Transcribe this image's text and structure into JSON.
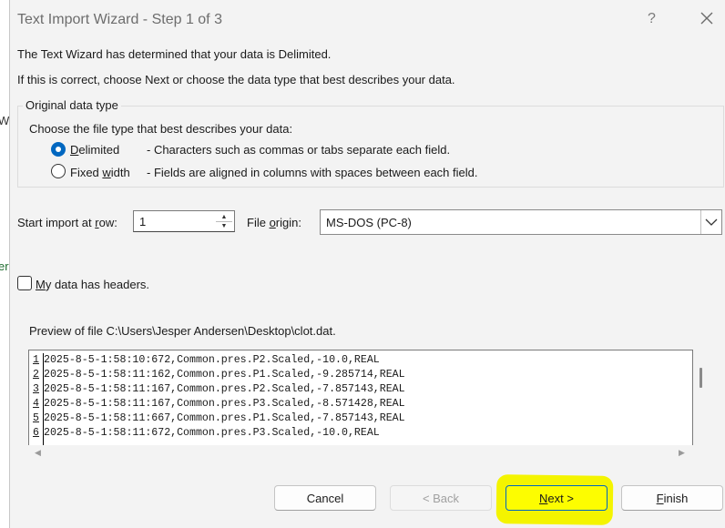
{
  "background": {
    "fragments": [
      "W",
      "er"
    ]
  },
  "dialog": {
    "title": "Text Import Wizard - Step 1 of 3",
    "help_label": "?",
    "intro_1": "The Text Wizard has determined that your data is Delimited.",
    "intro_2": "If this is correct, choose Next or choose the data type that best describes your data."
  },
  "original_type": {
    "legend": "Original data type",
    "prompt": "Choose the file type that best describes your data:",
    "options": [
      {
        "label_u": "D",
        "label_rest": "elimited",
        "desc": "- Characters such as commas or tabs separate each field.",
        "selected": true
      },
      {
        "label_pre": "Fixed ",
        "label_u": "w",
        "label_rest": "idth",
        "desc": "- Fields are aligned in columns with spaces between each field.",
        "selected": false
      }
    ]
  },
  "start_row": {
    "label_pre": "Start import at ",
    "label_u": "r",
    "label_rest": "ow:",
    "value": "1"
  },
  "file_origin": {
    "label_pre": "File ",
    "label_u": "o",
    "label_rest": "rigin:",
    "value": "MS-DOS (PC-8)"
  },
  "headers": {
    "label_u": "M",
    "label_rest": "y data has headers.",
    "checked": false
  },
  "preview": {
    "caption": "Preview of file C:\\Users\\Jesper Andersen\\Desktop\\clot.dat.",
    "rows": [
      {
        "num": "1",
        "text": "2025-8-5-1:58:10:672,Common.pres.P2.Scaled,-10.0,REAL"
      },
      {
        "num": "2",
        "text": "2025-8-5-1:58:11:162,Common.pres.P1.Scaled,-9.285714,REAL"
      },
      {
        "num": "3",
        "text": "2025-8-5-1:58:11:167,Common.pres.P2.Scaled,-7.857143,REAL"
      },
      {
        "num": "4",
        "text": "2025-8-5-1:58:11:167,Common.pres.P3.Scaled,-8.571428,REAL"
      },
      {
        "num": "5",
        "text": "2025-8-5-1:58:11:667,Common.pres.P1.Scaled,-7.857143,REAL"
      },
      {
        "num": "6",
        "text": "2025-8-5-1:58:11:672,Common.pres.P3.Scaled,-10.0,REAL"
      }
    ]
  },
  "buttons": {
    "cancel": "Cancel",
    "back": "< Back",
    "next_u": "N",
    "next_rest": "ext >",
    "finish_u": "F",
    "finish_rest": "inish"
  },
  "colors": {
    "accent": "#0067c0",
    "highlight": "#f4f400",
    "dialog_bg": "#f3f3f3"
  },
  "icons": [
    "close-icon",
    "spin-up-icon",
    "spin-down-icon",
    "chevron-down-icon",
    "scroll-left-icon",
    "scroll-right-icon"
  ]
}
